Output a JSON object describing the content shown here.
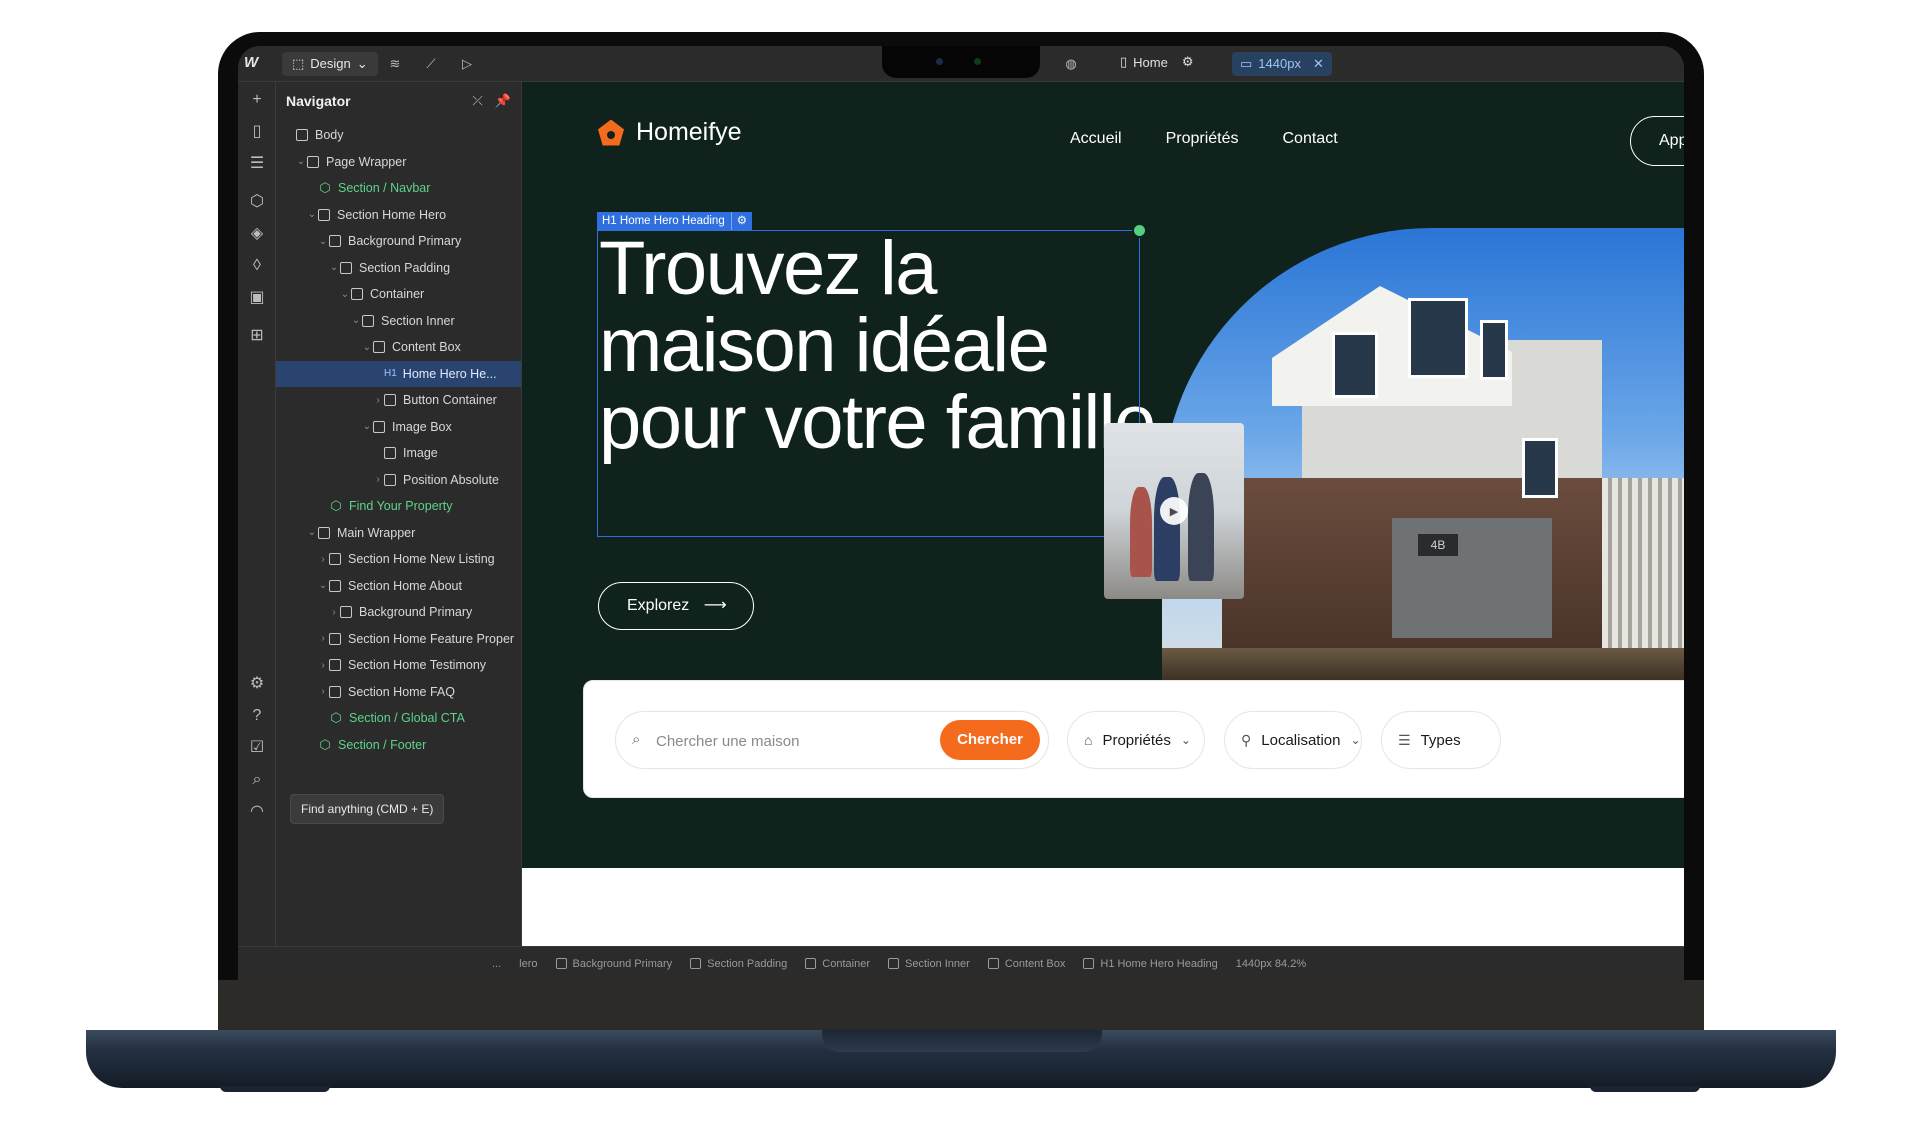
{
  "app": {
    "mode_label": "Design",
    "page_name": "Home",
    "breakpoint": "1440px"
  },
  "navigator": {
    "title": "Navigator",
    "tree": [
      {
        "label": "Body",
        "depth": 0,
        "type": "box",
        "chev": ""
      },
      {
        "label": "Page Wrapper",
        "depth": 1,
        "type": "box",
        "chev": "v"
      },
      {
        "label": "Section / Navbar",
        "depth": 2,
        "type": "component",
        "chev": ""
      },
      {
        "label": "Section Home Hero",
        "depth": 2,
        "type": "box",
        "chev": "v"
      },
      {
        "label": "Background Primary",
        "depth": 3,
        "type": "box",
        "chev": "v"
      },
      {
        "label": "Section Padding",
        "depth": 4,
        "type": "box",
        "chev": "v"
      },
      {
        "label": "Container",
        "depth": 5,
        "type": "box",
        "chev": "v"
      },
      {
        "label": "Section Inner",
        "depth": 6,
        "type": "box",
        "chev": "v"
      },
      {
        "label": "Content Box",
        "depth": 7,
        "type": "box",
        "chev": "v"
      },
      {
        "label": "Home Hero He...",
        "depth": 8,
        "type": "h1",
        "chev": "",
        "selected": true
      },
      {
        "label": "Button Container",
        "depth": 8,
        "type": "box",
        "chev": ">"
      },
      {
        "label": "Image Box",
        "depth": 7,
        "type": "box",
        "chev": "v"
      },
      {
        "label": "Image",
        "depth": 8,
        "type": "image",
        "chev": ""
      },
      {
        "label": "Position Absolute",
        "depth": 8,
        "type": "box",
        "chev": ">"
      },
      {
        "label": "Find Your Property",
        "depth": 3,
        "type": "component",
        "chev": ""
      },
      {
        "label": "Main Wrapper",
        "depth": 2,
        "type": "box",
        "chev": "v"
      },
      {
        "label": "Section Home New Listing",
        "depth": 3,
        "type": "box",
        "chev": ">"
      },
      {
        "label": "Section Home About",
        "depth": 3,
        "type": "box",
        "chev": "v"
      },
      {
        "label": "Background Primary",
        "depth": 4,
        "type": "box",
        "chev": ">"
      },
      {
        "label": "Section Home Feature Proper",
        "depth": 3,
        "type": "box",
        "chev": ">"
      },
      {
        "label": "Section Home Testimony",
        "depth": 3,
        "type": "box",
        "chev": ">"
      },
      {
        "label": "Section Home FAQ",
        "depth": 3,
        "type": "box",
        "chev": ">"
      },
      {
        "label": "Section / Global CTA",
        "depth": 3,
        "type": "component",
        "chev": ""
      },
      {
        "label": "Section / Footer",
        "depth": 2,
        "type": "component",
        "chev": ""
      }
    ]
  },
  "tooltip": "Find anything (CMD + E)",
  "site": {
    "brand": "Homeifye",
    "menu": [
      "Accueil",
      "Propriétés",
      "Contact"
    ],
    "cta": "Appe",
    "selection_label": "H1  Home Hero Heading",
    "heading": "Trouvez la maison idéale pour votre famille",
    "explore": "Explorez",
    "search_placeholder": "Chercher une maison",
    "search_button": "Chercher",
    "filters": [
      {
        "label": "Propriétés",
        "icon": "home-icon"
      },
      {
        "label": "Localisation",
        "icon": "location-pin-icon"
      },
      {
        "label": "Types",
        "icon": "list-filter-icon"
      }
    ],
    "mailbox_number": "4B"
  },
  "bottom_breadcrumb": [
    "...",
    "lero",
    "Background Primary",
    "Section Padding",
    "Container",
    "Section Inner",
    "Content Box",
    "H1  Home Hero Heading",
    "1440px  84.2%"
  ],
  "colors": {
    "hero_bg": "#0f221c",
    "accent": "#f56b1e",
    "selection": "#2f6fe0",
    "component": "#5ed38a"
  }
}
